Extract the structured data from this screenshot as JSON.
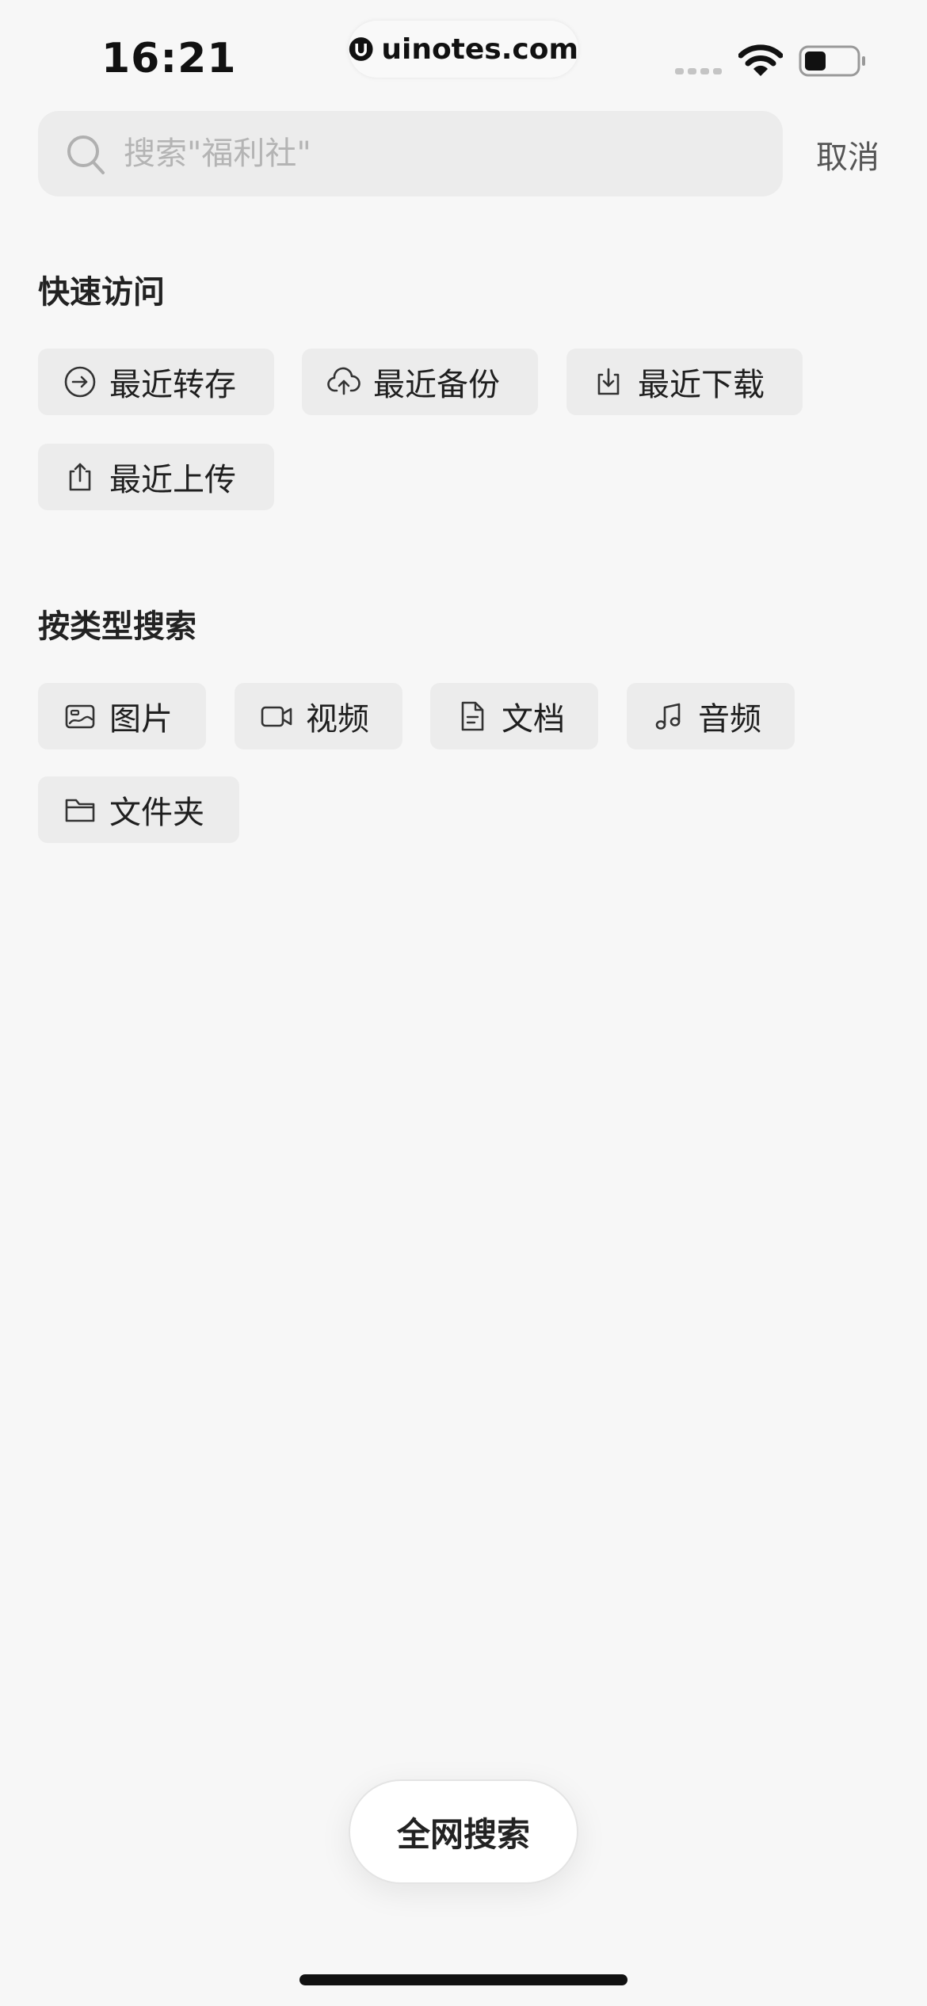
{
  "status": {
    "time": "16:21",
    "watermark": "uinotes.com"
  },
  "search": {
    "placeholder": "搜索\"福利社\"",
    "value": "",
    "cancel_label": "取消"
  },
  "quick_access": {
    "title": "快速访问",
    "items": [
      {
        "label": "最近转存",
        "icon": "arrow-circle-right-icon"
      },
      {
        "label": "最近备份",
        "icon": "cloud-upload-icon"
      },
      {
        "label": "最近下载",
        "icon": "download-icon"
      },
      {
        "label": "最近上传",
        "icon": "upload-icon"
      }
    ]
  },
  "type_search": {
    "title": "按类型搜索",
    "items": [
      {
        "label": "图片",
        "icon": "image-icon"
      },
      {
        "label": "视频",
        "icon": "video-icon"
      },
      {
        "label": "文档",
        "icon": "document-icon"
      },
      {
        "label": "音频",
        "icon": "music-note-icon"
      },
      {
        "label": "文件夹",
        "icon": "folder-icon"
      }
    ]
  },
  "full_search_label": "全网搜索"
}
